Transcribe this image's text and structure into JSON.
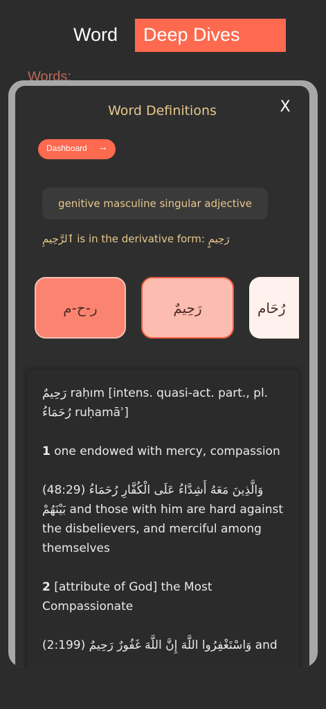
{
  "header": {
    "title_part1": "Word",
    "title_part2": "Deep Dives"
  },
  "background_text": "Words:",
  "modal": {
    "title": "Word Definitions",
    "close_label": "X",
    "dashboard_button": {
      "label": "Dashboard",
      "arrow": "→"
    },
    "grammar_text": "genitive masculine singular adjective",
    "derivative_text": "ٱلرَّحِيمِ is in the derivative form: رَحِيمٍ",
    "cards": [
      {
        "label": "ر-ح-م"
      },
      {
        "label": "رَحِيمٌ"
      },
      {
        "label": "رُحَام"
      }
    ],
    "definitions": {
      "head": "رَحِيمٌ raḥım [intens. quasi-act. part., pl. رُحَمَاءُ ruḥamāʾ]",
      "d1_num": "1",
      "d1_text": "one endowed with mercy, compassion",
      "quote1": "(48:29) وَالَّذِينَ مَعَهُ أَشِدَّاءُ عَلَى الْكُفَّارِ رُحَمَاءُ بَيْنَهُمْ and those with him are hard against the disbelievers, and merciful among themselves",
      "d2_num": "2",
      "d2_text": "[attribute of God] the Most Compassionate",
      "quote2": "(2:199) وَاسْتَغْفِرُوا اللَّهَ إِنَّ اللَّهَ غَفُورٌ رَحِيمٌ and"
    }
  },
  "colors": {
    "accent": "#fd6a4f",
    "gold": "#e8c88d",
    "background": "#2c2c2c"
  }
}
